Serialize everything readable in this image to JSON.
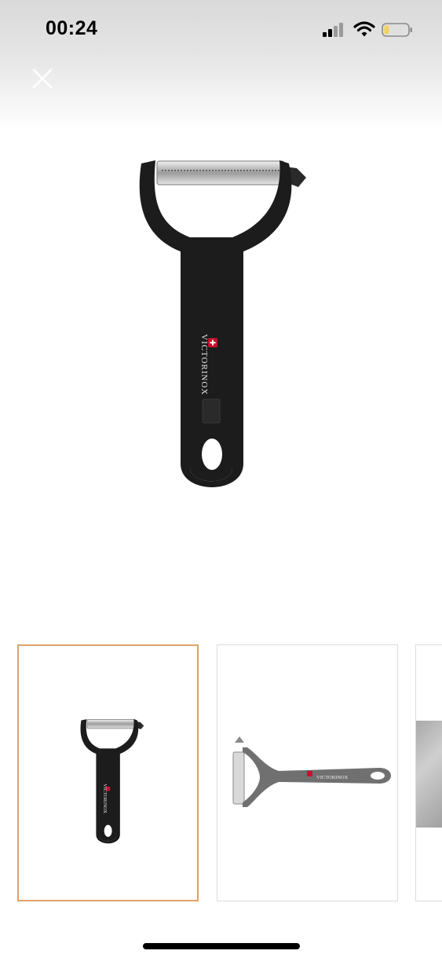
{
  "status_bar": {
    "time": "00:24",
    "icons": [
      "signal-icon",
      "wifi-icon",
      "battery-icon"
    ]
  },
  "header": {
    "close_icon": "close-icon"
  },
  "main_image": {
    "brand_text": "VICTORINOX",
    "description": "product-photo"
  },
  "thumbnails": [
    {
      "id": "thumb-1",
      "selected": true,
      "brand_text": "VICTORINOX"
    },
    {
      "id": "thumb-2",
      "selected": false,
      "brand_text": "VICTORINOX"
    },
    {
      "id": "thumb-3",
      "selected": false
    }
  ],
  "colors": {
    "selected_border": "#e0a168",
    "handle_black": "#1c1c1c",
    "handle_grey": "#6e6e6e",
    "logo_red": "#c8102e"
  }
}
